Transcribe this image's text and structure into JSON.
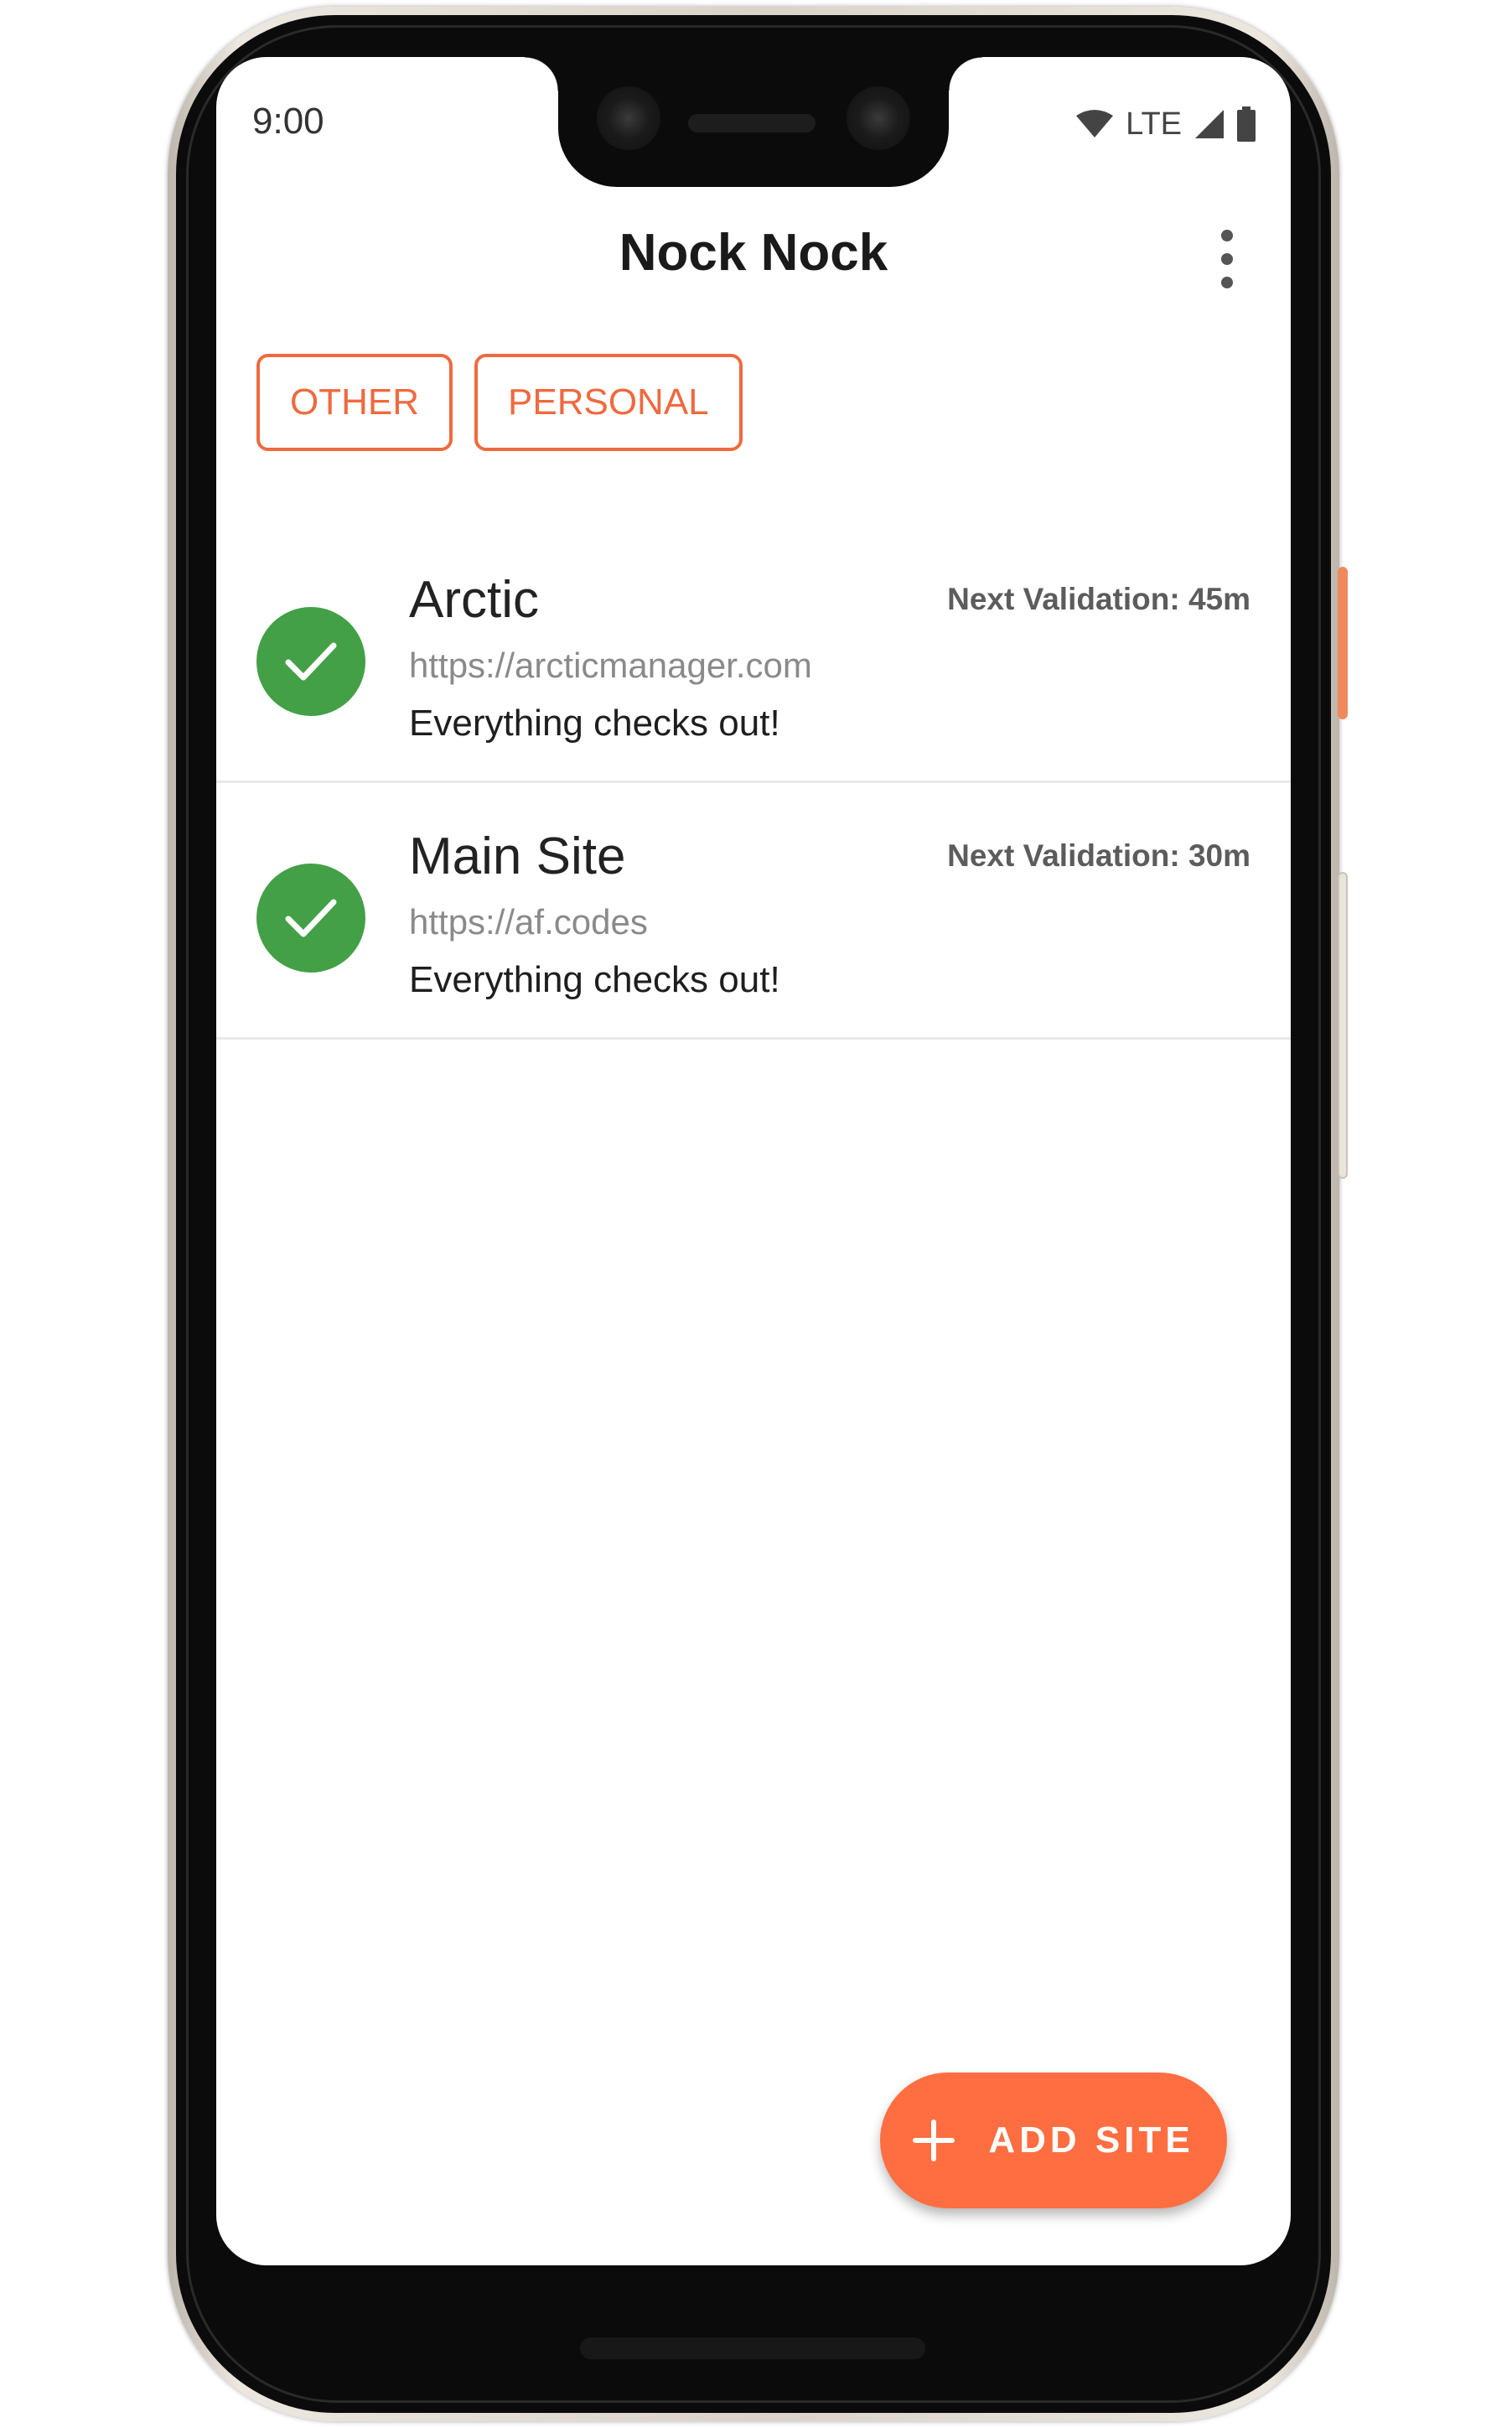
{
  "status_bar": {
    "time": "9:00",
    "network": "LTE",
    "icons": [
      "wifi-icon",
      "signal-icon",
      "battery-icon"
    ]
  },
  "header": {
    "title": "Nock Nock",
    "menu_icon": "more-vert-icon"
  },
  "filters": {
    "chips": [
      {
        "label": "OTHER"
      },
      {
        "label": "PERSONAL"
      }
    ]
  },
  "sites": [
    {
      "name": "Arctic",
      "url": "https://arcticmanager.com",
      "message": "Everything checks out!",
      "next_validation": "Next Validation: 45m",
      "status_icon": "check-icon"
    },
    {
      "name": "Main Site",
      "url": "https://af.codes",
      "message": "Everything checks out!",
      "next_validation": "Next Validation: 30m",
      "status_icon": "check-icon"
    }
  ],
  "fab": {
    "label": "ADD SITE",
    "icon": "plus-icon"
  },
  "colors": {
    "accent": "#ff6e40",
    "chip_border": "#ef6a3f",
    "status_ok": "#43a047",
    "title_text": "#1a1a1a"
  }
}
